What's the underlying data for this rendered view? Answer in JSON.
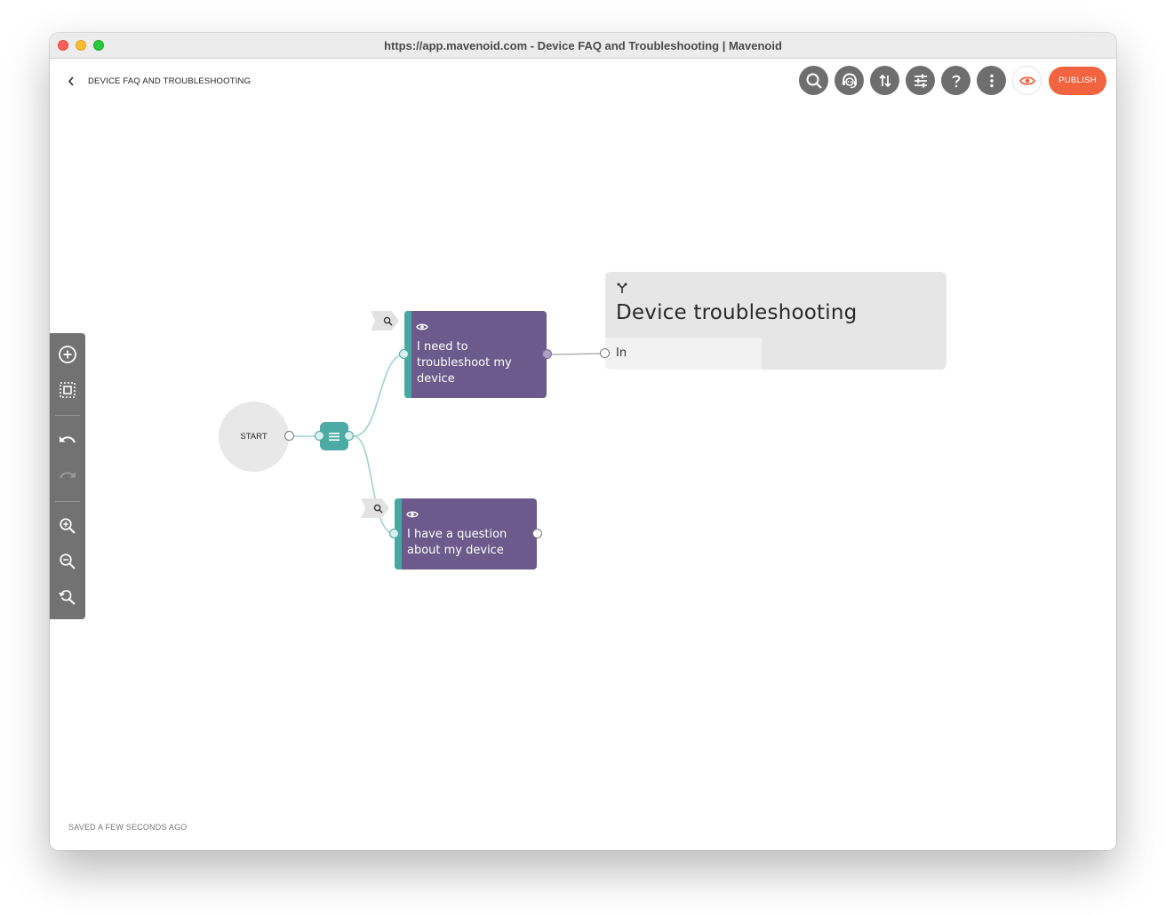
{
  "window": {
    "title": "https://app.mavenoid.com - Device FAQ and Troubleshooting | Mavenoid"
  },
  "header": {
    "back_icon": "chevron-left-icon",
    "flow_title": "DEVICE FAQ AND TROUBLESHOOTING",
    "toolbar": [
      {
        "name": "search",
        "icon": "search-icon"
      },
      {
        "name": "assistant",
        "icon": "support-agent-icon"
      },
      {
        "name": "import-export",
        "icon": "import-export-icon"
      },
      {
        "name": "settings",
        "icon": "sliders-icon"
      },
      {
        "name": "help",
        "icon": "question-icon"
      },
      {
        "name": "more",
        "icon": "more-vertical-icon"
      },
      {
        "name": "preview",
        "icon": "eye-icon"
      }
    ],
    "publish_label": "PUBLISH",
    "accent_color": "#f26340"
  },
  "side_toolbar": {
    "buttons": [
      {
        "name": "add-node",
        "icon": "add-circle-icon"
      },
      {
        "name": "select-area",
        "icon": "select-frame-icon"
      },
      {
        "name": "undo",
        "icon": "undo-icon"
      },
      {
        "name": "redo",
        "icon": "redo-icon",
        "disabled": true
      },
      {
        "name": "zoom-in",
        "icon": "zoom-in-icon"
      },
      {
        "name": "zoom-out",
        "icon": "zoom-out-icon"
      },
      {
        "name": "zoom-reset",
        "icon": "zoom-reset-icon"
      }
    ]
  },
  "canvas": {
    "start_label": "START",
    "menu_icon": "menu-lines-icon",
    "options": [
      {
        "label": "I need to troubleshoot my device",
        "icon": "eye-icon"
      },
      {
        "label": "I have a question about my device",
        "icon": "eye-icon"
      }
    ],
    "subflow": {
      "icon": "branch-icon",
      "title": "Device troubleshooting",
      "input_label": "In"
    },
    "colors": {
      "option_fill": "#6c5a8c",
      "teal": "#47a8a2",
      "edge": "#9fd2ce"
    }
  },
  "status": {
    "saved_text": "SAVED A FEW SECONDS AGO"
  }
}
